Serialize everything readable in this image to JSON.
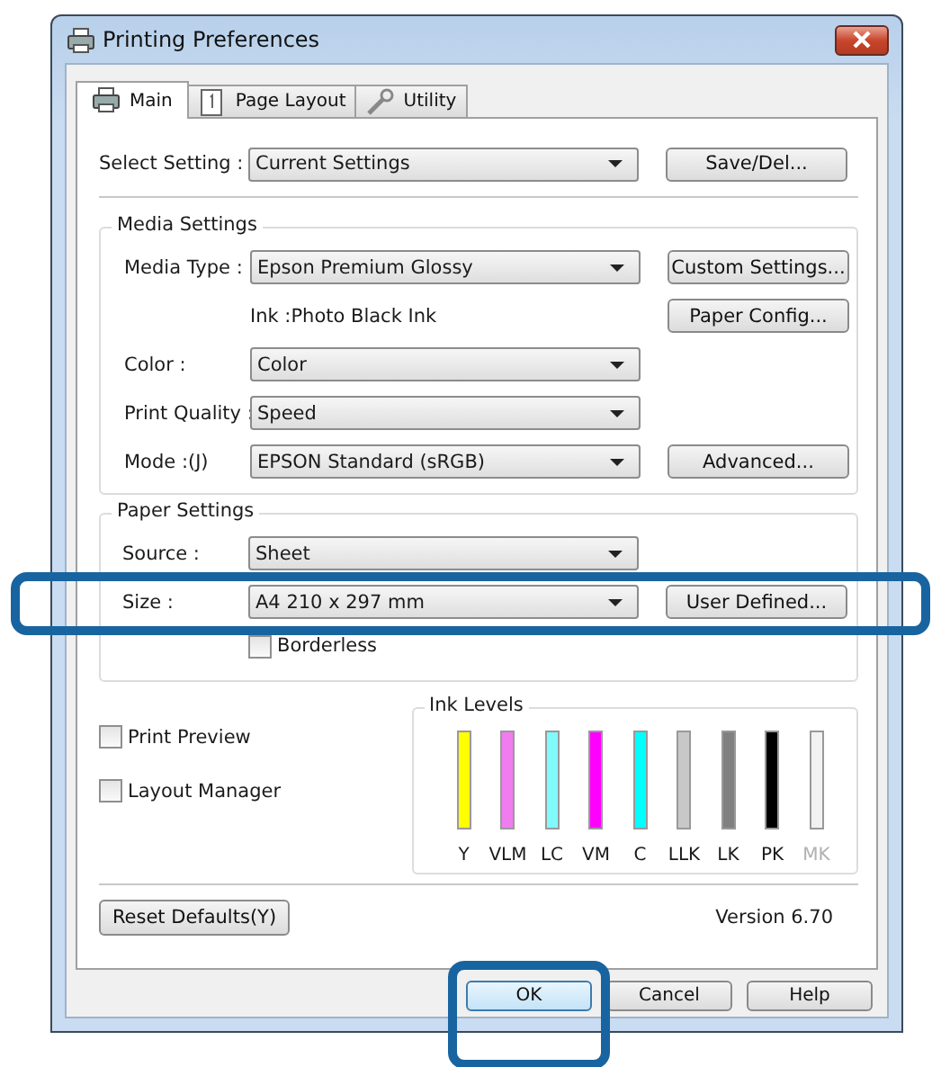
{
  "window": {
    "title": "Printing Preferences"
  },
  "tabs": [
    {
      "label": "Main",
      "selected": true
    },
    {
      "label": "Page Layout",
      "selected": false
    },
    {
      "label": "Utility",
      "selected": false
    }
  ],
  "select_setting": {
    "label": "Select Setting :",
    "value": "Current Settings",
    "button": "Save/Del..."
  },
  "media_settings": {
    "title": "Media Settings",
    "rows": [
      {
        "kind": "combo",
        "label": "Media Type :",
        "value": "Epson Premium Glossy",
        "button": "Custom Settings...",
        "highlighted": false
      },
      {
        "kind": "info",
        "text": "Ink :Photo Black Ink",
        "button": "Paper Config...",
        "highlighted": false
      },
      {
        "kind": "combo",
        "label": "Color :",
        "value": "Color",
        "highlighted": false
      },
      {
        "kind": "combo",
        "label": "Print Quality :",
        "value": "Speed",
        "highlighted": false
      },
      {
        "kind": "combo",
        "label": "Mode :(J)",
        "value": "EPSON Standard (sRGB)",
        "button": "Advanced...",
        "highlighted": false
      }
    ]
  },
  "paper_settings": {
    "title": "Paper Settings",
    "rows": [
      {
        "kind": "combo",
        "label": "Source :",
        "value": "Sheet",
        "highlighted": false
      },
      {
        "kind": "combo",
        "label": "Size :",
        "value": "A4 210 x 297 mm",
        "button": "User Defined...",
        "highlighted": true
      },
      {
        "kind": "checkbox",
        "label": "Borderless",
        "checked": false,
        "highlighted": false
      }
    ]
  },
  "options": [
    {
      "label": "Print Preview",
      "checked": false
    },
    {
      "label": "Layout Manager",
      "checked": false
    }
  ],
  "ink_levels": {
    "title": "Ink Levels",
    "inks": [
      {
        "name": "Y",
        "color": "#ffff00",
        "level": 1,
        "disabled": false
      },
      {
        "name": "VLM",
        "color": "#f07cf0",
        "level": 1,
        "disabled": false
      },
      {
        "name": "LC",
        "color": "#80fafa",
        "level": 1,
        "disabled": false
      },
      {
        "name": "VM",
        "color": "#ff00ff",
        "level": 1,
        "disabled": false
      },
      {
        "name": "C",
        "color": "#00ffff",
        "level": 1,
        "disabled": false
      },
      {
        "name": "LLK",
        "color": "#c8c8c8",
        "level": 1,
        "disabled": false
      },
      {
        "name": "LK",
        "color": "#808080",
        "level": 1,
        "disabled": false
      },
      {
        "name": "PK",
        "color": "#000000",
        "level": 1,
        "disabled": false
      },
      {
        "name": "MK",
        "color": "#f2f2f2",
        "level": 1,
        "disabled": true
      }
    ]
  },
  "reset_button": "Reset Defaults(Y)",
  "version": "Version 6.70",
  "buttons": [
    {
      "label": "OK",
      "default": true,
      "highlighted": true
    },
    {
      "label": "Cancel",
      "default": false,
      "highlighted": false
    },
    {
      "label": "Help",
      "default": false,
      "highlighted": false
    }
  ]
}
